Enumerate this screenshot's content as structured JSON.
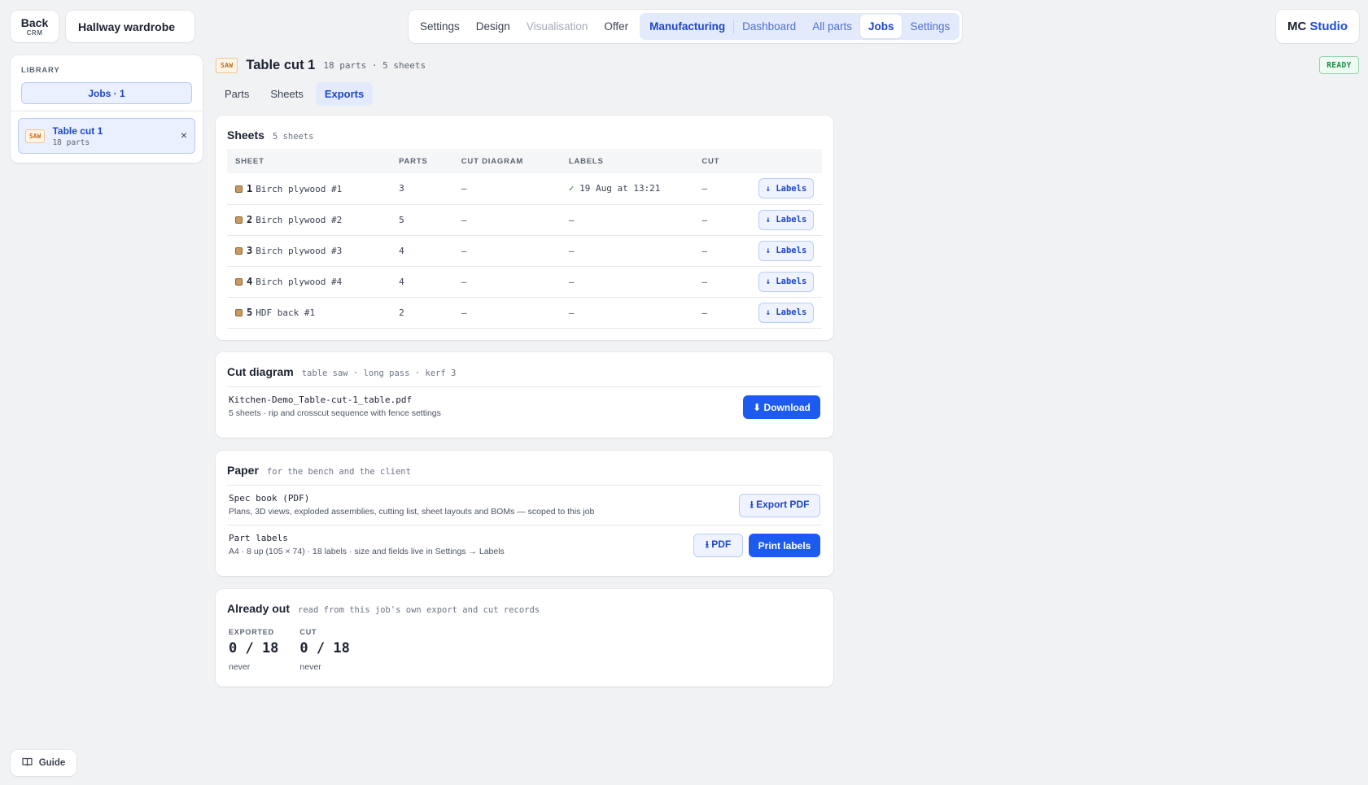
{
  "back": {
    "label": "Back",
    "sublabel": "CRM"
  },
  "project": {
    "title": "Hallway wardrobe"
  },
  "nav": {
    "items": [
      "Settings",
      "Design",
      "Visualisation",
      "Offer"
    ],
    "group": [
      "Manufacturing",
      "Dashboard",
      "All parts",
      "Jobs",
      "Settings"
    ],
    "active": "Jobs"
  },
  "brand": {
    "part1": "MC",
    "part2": "Studio"
  },
  "sidebar": {
    "library_label": "LIBRARY",
    "jobs_pill": "Jobs · 1",
    "job": {
      "tag": "SAW",
      "title": "Table cut 1",
      "sub": "18 parts",
      "close": "×"
    }
  },
  "header": {
    "tag": "SAW",
    "title": "Table cut 1",
    "meta": "18 parts · 5 sheets",
    "status": "READY"
  },
  "tabs": [
    "Parts",
    "Sheets",
    "Exports"
  ],
  "sheets": {
    "title": "Sheets",
    "sub": "5 sheets",
    "columns": [
      "SHEET",
      "PARTS",
      "CUT DIAGRAM",
      "LABELS",
      "CUT"
    ],
    "button_label": "↓ Labels",
    "rows": [
      {
        "num": "1",
        "name": "Birch plywood #1",
        "parts": "3",
        "cut_diagram": "—",
        "labels": "19 Aug at 13:21",
        "labels_done": true,
        "cut": "—"
      },
      {
        "num": "2",
        "name": "Birch plywood #2",
        "parts": "5",
        "cut_diagram": "—",
        "labels": "—",
        "labels_done": false,
        "cut": "—"
      },
      {
        "num": "3",
        "name": "Birch plywood #3",
        "parts": "4",
        "cut_diagram": "—",
        "labels": "—",
        "labels_done": false,
        "cut": "—"
      },
      {
        "num": "4",
        "name": "Birch plywood #4",
        "parts": "4",
        "cut_diagram": "—",
        "labels": "—",
        "labels_done": false,
        "cut": "—"
      },
      {
        "num": "5",
        "name": "HDF back #1",
        "parts": "2",
        "cut_diagram": "—",
        "labels": "—",
        "labels_done": false,
        "cut": "—"
      }
    ]
  },
  "cut_diagram": {
    "title": "Cut diagram",
    "sub": "table saw · long pass · kerf 3",
    "file": "Kitchen-Demo_Table-cut-1_table.pdf",
    "desc": "5 sheets · rip and crosscut sequence with fence settings",
    "button": "⬇ Download"
  },
  "paper": {
    "title": "Paper",
    "sub": "for the bench and the client",
    "spec_title": "Spec book (PDF)",
    "spec_desc": "Plans, 3D views, exploded assemblies, cutting list, sheet layouts and BOMs — scoped to this job",
    "spec_button": "⭳ Export PDF",
    "labels_title": "Part labels",
    "labels_desc": "A4 · 8 up (105 × 74) · 18 labels · size and fields live in Settings → Labels",
    "pdf_button": "⭳ PDF",
    "print_button": "Print labels"
  },
  "already_out": {
    "title": "Already out",
    "sub": "read from this job's own export and cut records",
    "exported_label": "EXPORTED",
    "exported_value": "0 / 18",
    "exported_note": "never",
    "cut_label": "CUT",
    "cut_value": "0 / 18",
    "cut_note": "never"
  },
  "guide": {
    "label": "Guide"
  },
  "colors": {
    "accent": "#1d5bf0",
    "ready": "#1d8a43",
    "saw": "#c56b16"
  }
}
